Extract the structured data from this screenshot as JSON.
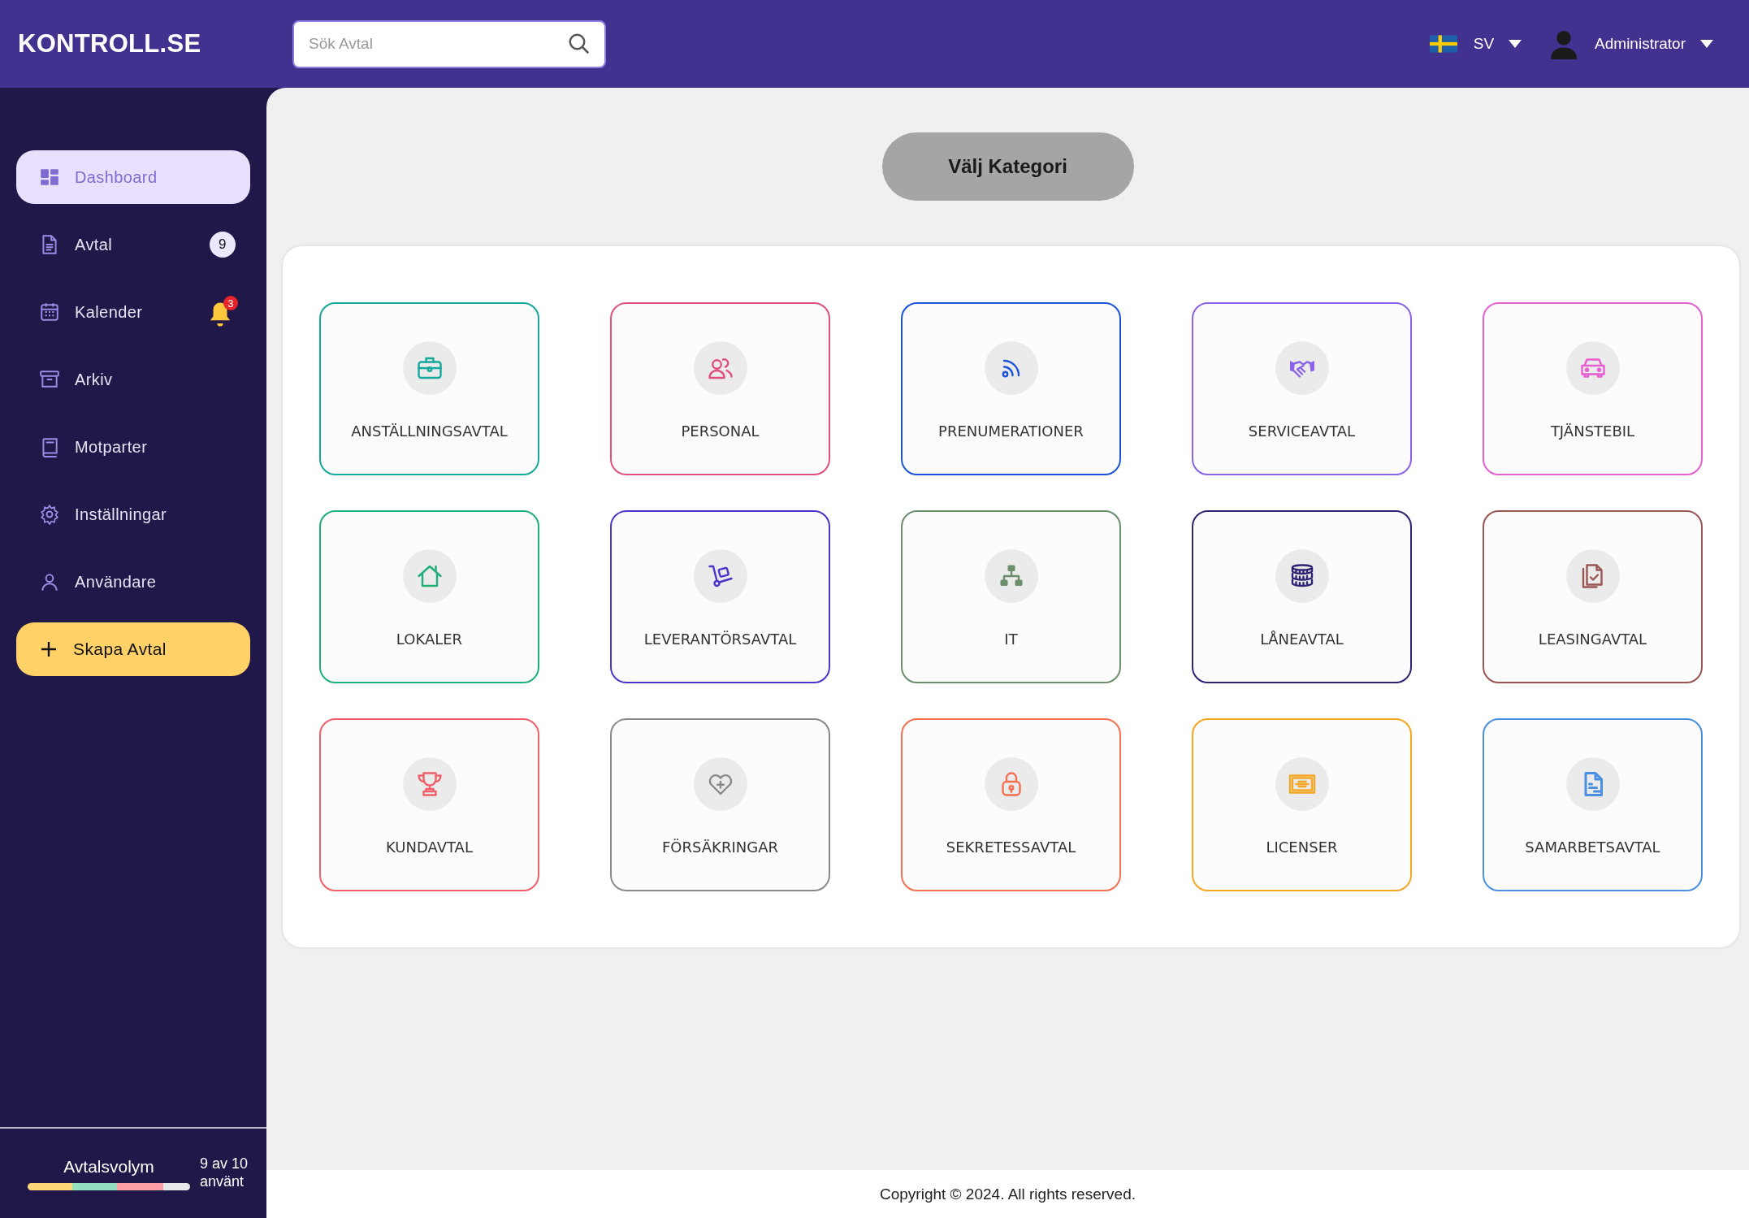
{
  "header": {
    "logo": "KONTROLL.SE",
    "search": {
      "placeholder": "Sök Avtal"
    },
    "language": "SV",
    "user": "Administrator"
  },
  "sidebar": {
    "items": [
      {
        "label": "Dashboard",
        "selected": true
      },
      {
        "label": "Avtal",
        "selected": false,
        "badge": "9"
      },
      {
        "label": "Kalender",
        "selected": false,
        "alert_count": "3"
      },
      {
        "label": "Arkiv",
        "selected": false
      },
      {
        "label": "Motparter",
        "selected": false
      },
      {
        "label": "Inställningar",
        "selected": false
      },
      {
        "label": "Användare",
        "selected": false
      }
    ],
    "create_button": "Skapa Avtal",
    "usage": {
      "label": "Avtalsvolym",
      "reading": "9 av 10 använt"
    }
  },
  "main": {
    "category_button": "Välj Kategori",
    "categories": [
      {
        "label": "ANSTÄLLNINGSAVTAL",
        "color": "#16a89b"
      },
      {
        "label": "PERSONAL",
        "color": "#e0507f"
      },
      {
        "label": "PRENUMERATIONER",
        "color": "#1b54d6"
      },
      {
        "label": "SERVICEAVTAL",
        "color": "#8a63e6"
      },
      {
        "label": "TJÄNSTEBIL",
        "color": "#e65fd0"
      },
      {
        "label": "LOKALER",
        "color": "#1fb07a"
      },
      {
        "label": "LEVERANTÖRSAVTAL",
        "color": "#4b35c9"
      },
      {
        "label": "IT",
        "color": "#6b8e6b"
      },
      {
        "label": "LÅNEAVTAL",
        "color": "#2d2473"
      },
      {
        "label": "LEASINGAVTAL",
        "color": "#9a5555"
      },
      {
        "label": "KUNDAVTAL",
        "color": "#f0606a"
      },
      {
        "label": "FÖRSÄKRINGAR",
        "color": "#8a8a8a"
      },
      {
        "label": "SEKRETESSAVTAL",
        "color": "#f57050"
      },
      {
        "label": "LICENSER",
        "color": "#f5a623"
      },
      {
        "label": "SAMARBETSAVTAL",
        "color": "#4a90e2"
      }
    ]
  },
  "footer": "Copyright © 2024. All rights reserved."
}
